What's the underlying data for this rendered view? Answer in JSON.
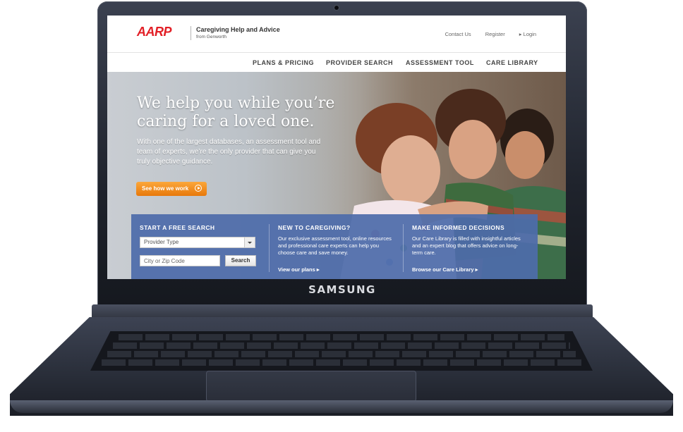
{
  "device": {
    "brand": "SAMSUNG"
  },
  "header": {
    "logo": "AARP",
    "tagline": "Caregiving Help and Advice",
    "tagline_from": "from Genworth",
    "util_links": [
      "Contact Us",
      "Register",
      "▸ Login"
    ]
  },
  "nav": {
    "items": [
      "PLANS & PRICING",
      "PROVIDER SEARCH",
      "ASSESSMENT TOOL",
      "CARE LIBRARY"
    ]
  },
  "hero": {
    "headline": "We help you while you’re caring for a loved one.",
    "subtext": "With one of the largest databases, an assessment tool and team of experts, we’re the only provider that can give you truly objective guidance.",
    "cta_label": "See how we work"
  },
  "panel": {
    "search": {
      "title": "START A FREE SEARCH",
      "provider_type": "Provider Type",
      "location_placeholder": "City or Zip Code",
      "search_label": "Search"
    },
    "new": {
      "title": "NEW TO CAREGIVING?",
      "text": "Our exclusive assessment tool, online resources and professional care experts can help you choose care and save money.",
      "link": "View our plans ▸"
    },
    "informed": {
      "title": "MAKE INFORMED DECISIONS",
      "text": "Our Care Library is filled with insightful articles and an expert blog that offers advice on long-term care.",
      "link": "Browse our Care Library ▸"
    }
  },
  "colors": {
    "brand_red": "#e21f26",
    "cta_orange": "#f08d1e",
    "panel_blue": "#4e6caa"
  }
}
